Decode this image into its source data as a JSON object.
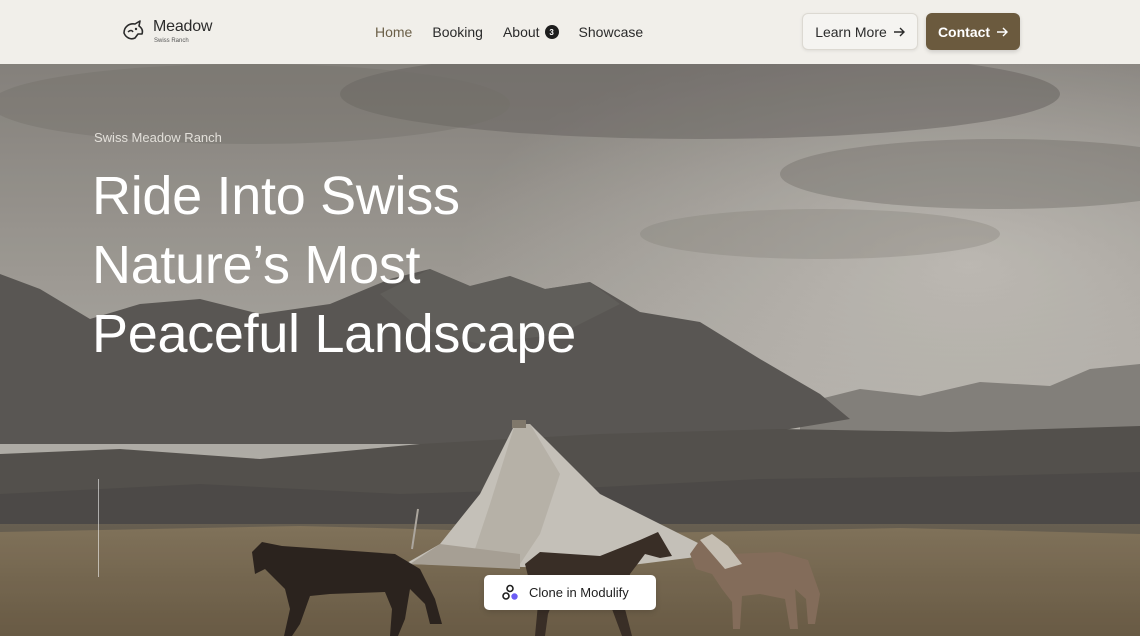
{
  "brand": {
    "name": "Meadow",
    "subtitle": "Swiss Ranch",
    "logo_icon": "horse-head-icon"
  },
  "nav": {
    "items": [
      {
        "label": "Home",
        "active": true
      },
      {
        "label": "Booking",
        "active": false
      },
      {
        "label": "About",
        "active": false,
        "badge": "3"
      },
      {
        "label": "Showcase",
        "active": false
      }
    ]
  },
  "actions": {
    "learn_more": "Learn More",
    "contact": "Contact",
    "arrow_icon": "arrow-right-icon"
  },
  "hero": {
    "eyebrow": "Swiss Meadow Ranch",
    "headline_lines": [
      "Ride Into Swiss",
      "Nature’s Most",
      "Peaceful Landscape"
    ]
  },
  "clone_button": {
    "label": "Clone in Modulify",
    "icon": "modulify-icon"
  },
  "colors": {
    "accent": "#6b5a3e",
    "active_nav": "#6b5f48",
    "header_bg": "#f1efea"
  }
}
